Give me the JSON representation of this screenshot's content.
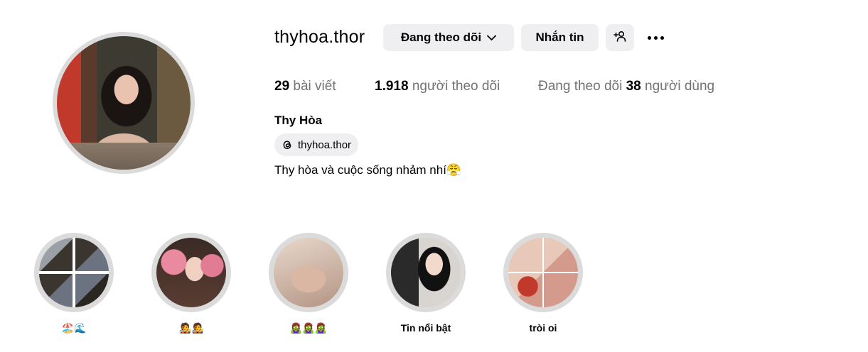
{
  "profile": {
    "username": "thyhoa.thor",
    "full_name": "Thy Hòa",
    "threads_handle": "thyhoa.thor",
    "bio": "Thy hòa và cuộc sống nhảm nhí😤"
  },
  "actions": {
    "following_label": "Đang theo dõi",
    "message_label": "Nhắn tin"
  },
  "stats": {
    "posts_count": "29",
    "posts_label": "bài viết",
    "followers_count": "1.918",
    "followers_label": "người theo dõi",
    "following_prefix": "Đang theo dõi",
    "following_count": "38",
    "following_suffix": "người dùng"
  },
  "highlights": [
    {
      "label": "🏖️🌊"
    },
    {
      "label": "🧑‍🎤🧑‍🎤"
    },
    {
      "label": "🧟‍♀️🧟‍♀️🧟‍♀️"
    },
    {
      "label": "Tin nổi bật"
    },
    {
      "label": "tròi oi"
    }
  ],
  "colors": {
    "button_bg": "#efeff2",
    "ring": "#dbdbdb",
    "muted_text": "#737373"
  }
}
